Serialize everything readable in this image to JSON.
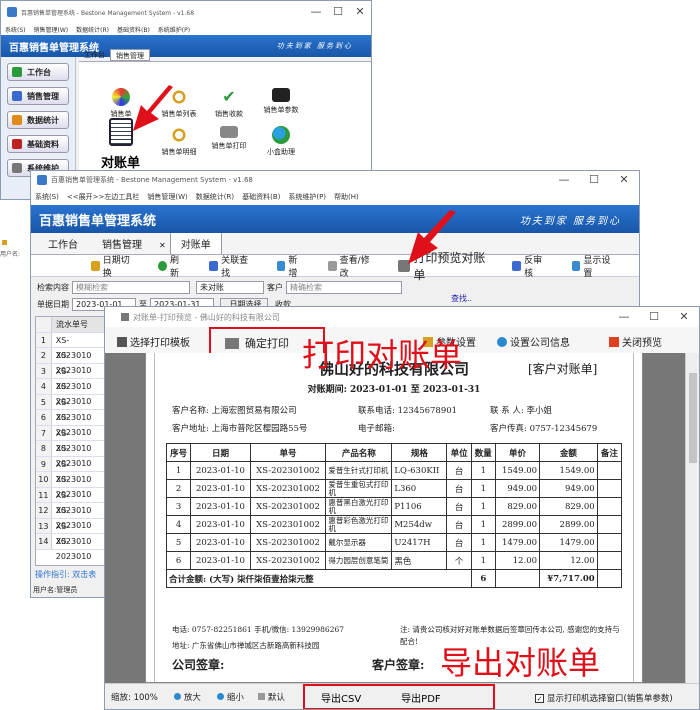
{
  "win1": {
    "title": "百惠销售单管理系统 - Bestone Management System - v1.68",
    "menu": [
      "系统(S)",
      "销售管理(W)",
      "数据统计(R)",
      "基础资料(B)",
      "系统维护(P)"
    ],
    "banner": "百惠销售单管理系统",
    "slogan": "功夫到家 服务到心",
    "tabs": [
      "工作台",
      "销售管理"
    ],
    "side": [
      "工作台",
      "销售管理",
      "数据统计",
      "基础资料",
      "系统维护"
    ],
    "icons": [
      "销售单",
      "销售单列表",
      "销售收款",
      "销售单参数",
      "对账单",
      "销售单明细",
      "销售单打印",
      "小盒助理"
    ],
    "duizhang_label": "对账单"
  },
  "win2": {
    "title": "百惠销售单管理系统 - Bestone Management System - v1.68",
    "menu": [
      "系统(S)",
      "<<展开>>左边工具栏",
      "销售管理(W)",
      "数据统计(R)",
      "基础资料(B)",
      "系统维护(P)",
      "帮助(H)"
    ],
    "banner": "百惠销售单管理系统",
    "slogan": "功夫到家 服务到心",
    "tabs": [
      "工作台",
      "销售管理",
      "对账单"
    ],
    "toolbar": [
      "日期切换",
      "刷新",
      "关联查找",
      "新增",
      "查看/修改",
      "打印预览对账单",
      "反审核",
      "显示设置"
    ],
    "filter": {
      "content_label": "检索内容",
      "content_value": "模糊检索",
      "status_value": "未对账",
      "customer_label": "客户",
      "customer_placeholder": "精确检索",
      "date_label": "单据日期",
      "date_from": "2023-01-01",
      "date_to": "2023-01-31",
      "date_btn": "日期选择",
      "receipt_label": "收款",
      "search_btn": "查找.."
    },
    "grid_header": "流水单号",
    "grid_rows": [
      "XS-2023010",
      "XS-2023010",
      "XS-2023010",
      "XS-2023010",
      "XS-2023010",
      "XS-2023010",
      "XS-2023010",
      "XS-2023010",
      "XS-2023010",
      "XS-2023010",
      "XS-2023010",
      "XS-2023010",
      "XS-2023010",
      "XS-2023010"
    ],
    "hint": "操作指引: 双击表",
    "user": "用户名:管理员"
  },
  "left_strip": {
    "user": "用户名:"
  },
  "preview": {
    "title": "对账单-打印预览 - 佛山好的科技有限公司",
    "tool_template": "选择打印模板",
    "tool_confirm": "确定打印",
    "tool_setup": "参数设置",
    "tool_company": "设置公司信息",
    "tool_close": "关闭预览",
    "overlay_print": "打印对账单",
    "overlay_export": "导出对账单",
    "status": {
      "zoom": "缩放: 100%",
      "zoom_in": "放大",
      "zoom_out": "缩小",
      "default": "默认",
      "csv": "导出CSV",
      "pdf": "导出PDF",
      "checkbox": "显示打印机选择窗口(销售单参数)"
    }
  },
  "report": {
    "company": "佛山好的科技有限公司",
    "doc_type": "[客户对账单]",
    "period": "对账期间: 2023-01-01 至 2023-01-31",
    "customer_name": "客户名称: 上海宏图贸易有限公司",
    "customer_tel": "联系电话: 12345678901",
    "contact": "联 系 人: 李小姐",
    "customer_addr": "客户地址: 上海市普陀区樱园路55号",
    "email": "电子邮箱:",
    "fax": "客户传真: 0757-12345679",
    "headers": [
      "序号",
      "日期",
      "单号",
      "产品名称",
      "规格",
      "单位",
      "数量",
      "单价",
      "金额",
      "备注"
    ],
    "rows": [
      [
        "1",
        "2023-01-10",
        "XS-202301002",
        "爱普生针式打印机",
        "LQ-630KII",
        "台",
        "1",
        "1549.00",
        "1549.00",
        ""
      ],
      [
        "2",
        "2023-01-10",
        "XS-202301002",
        "爱普生重包式打印机",
        "L360",
        "台",
        "1",
        "949.00",
        "949.00",
        ""
      ],
      [
        "3",
        "2023-01-10",
        "XS-202301002",
        "惠普黑白激光打印机",
        "P1106",
        "台",
        "1",
        "829.00",
        "829.00",
        ""
      ],
      [
        "4",
        "2023-01-10",
        "XS-202301002",
        "惠普彩色激光打印机",
        "M254dw",
        "台",
        "1",
        "2899.00",
        "2899.00",
        ""
      ],
      [
        "5",
        "2023-01-10",
        "XS-202301002",
        "戴尔显示器",
        "U2417H",
        "台",
        "1",
        "1479.00",
        "1479.00",
        ""
      ],
      [
        "6",
        "2023-01-10",
        "XS-202301002",
        "得力园层创意笔筒",
        "黑色",
        "个",
        "1",
        "12.00",
        "12.00",
        ""
      ]
    ],
    "total_label": "合计金额: (大写) 柒仟柒佰壹拾柒元整",
    "total_qty": "6",
    "total_amount": "¥7,717.00",
    "tel": "电话: 0757-82251861 手机/微信: 13929986267",
    "note": "注: 请贵公司核对好对账单数据后签章回传本公司, 感谢您的支持与配合!",
    "addr": "地址: 广东省佛山市禅城区古新路高新科技园",
    "sign_company": "公司签章:",
    "sign_customer": "客户签章:"
  }
}
